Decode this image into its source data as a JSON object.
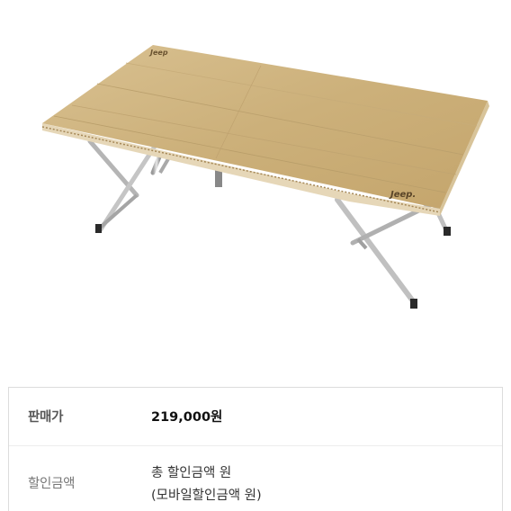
{
  "product": {
    "image_alt": "Jeep folding bamboo camping table",
    "brand_mark_1": "Jeep",
    "brand_mark_2": "Jeep."
  },
  "pricing": {
    "sale_price_label": "판매가",
    "sale_price_value": "219,000원",
    "discount_label": "할인금액",
    "discount_total": "총 할인금액 원",
    "discount_mobile": "(모바일할인금액 원)"
  }
}
